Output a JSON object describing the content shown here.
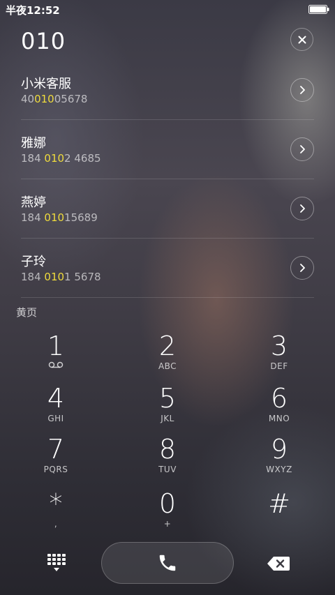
{
  "status_bar": {
    "time": "半夜12:52",
    "battery_icon": "battery-full-icon"
  },
  "dialer": {
    "dialed_number": "010",
    "clear_icon": "close-icon"
  },
  "results": [
    {
      "name": "小米客服",
      "number_prefix": "40",
      "number_match": "010",
      "number_suffix": "05678"
    },
    {
      "name": "雅娜",
      "number_prefix": "184 ",
      "number_match": "010",
      "number_suffix": "2 4685"
    },
    {
      "name": "燕婷",
      "number_prefix": "184 ",
      "number_match": "010",
      "number_suffix": "15689"
    },
    {
      "name": "子玲",
      "number_prefix": "184 ",
      "number_match": "010",
      "number_suffix": "1 5678"
    }
  ],
  "yellow_pages_label": "黄页",
  "keypad": {
    "keys": [
      {
        "digit": "1",
        "letters": "",
        "icon": "voicemail-icon"
      },
      {
        "digit": "2",
        "letters": "ABC"
      },
      {
        "digit": "3",
        "letters": "DEF"
      },
      {
        "digit": "4",
        "letters": "GHI"
      },
      {
        "digit": "5",
        "letters": "JKL"
      },
      {
        "digit": "6",
        "letters": "MNO"
      },
      {
        "digit": "7",
        "letters": "PQRS"
      },
      {
        "digit": "8",
        "letters": "TUV"
      },
      {
        "digit": "9",
        "letters": "WXYZ"
      },
      {
        "digit": "*",
        "letters": ","
      },
      {
        "digit": "0",
        "letters": "+"
      },
      {
        "digit": "#",
        "letters": ""
      }
    ]
  },
  "action_bar": {
    "keypad_toggle_icon": "dialpad-icon",
    "call_icon": "phone-icon",
    "backspace_icon": "backspace-icon"
  },
  "colors": {
    "match_highlight": "#f0dc3c"
  }
}
